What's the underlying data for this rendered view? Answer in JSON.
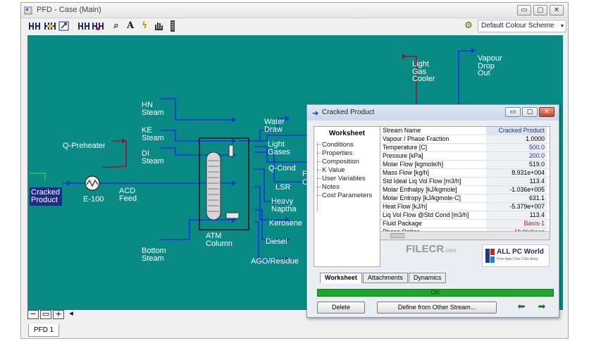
{
  "window": {
    "title": "PFD - Case (Main)",
    "min": "▭",
    "max": "▢",
    "close": "✕"
  },
  "toolbar": {
    "scheme_value": "Default Colour Scheme",
    "scheme_arrow": "▾",
    "icons": [
      "attach-icon",
      "detach-icon",
      "swap-icon",
      "break-icon",
      "merge-icon",
      "zoom-icon",
      "text-icon",
      "lightning-icon",
      "hand-icon",
      "column-icon",
      "palette-icon"
    ],
    "glyphs": {
      "text": "A",
      "zoom": "⌕",
      "lightning": "ϟ",
      "palette": "⚙"
    }
  },
  "pfd": {
    "feed_label": "Cracked\nProduct",
    "labels": {
      "q_preheater": "Q-Preheater",
      "e100": "E-100",
      "acd_feed": "ACD\nFeed",
      "hn_steam": "HN\nSteam",
      "ke_steam": "KE\nSteam",
      "di_steam": "DI\nSteam",
      "bottom_steam": "Bottom\nSteam",
      "atm_column": "ATM\nColumn",
      "water_draw": "Water\nDraw",
      "light_gases": "Light\nGases",
      "q_cond": "Q-Cond",
      "lsr": "LSR",
      "heavy_naptha": "Heavy\nNaptha",
      "kerosene": "Kerosene",
      "diesel": "Diesel",
      "ago_residue": "AGO/Residue",
      "light_gas_cooler": "Light\nGas\nCooler",
      "vapour_drop_out": "Vapour\nDrop\nOut",
      "partial_f": "F",
      "partial_c": "C"
    },
    "zoom_minus": "−",
    "zoom_fit": "▭",
    "zoom_plus": "+",
    "scroll_left": "◂",
    "tab": "PFD 1"
  },
  "dialog": {
    "title": "Cracked Product",
    "title_icon": "➜",
    "min": "▭",
    "max": "▢",
    "close": "✕",
    "nav_header": "Worksheet",
    "nav_items": [
      "Conditions",
      "Properties",
      "Composition",
      "K Value",
      "User Variables",
      "Notes",
      "Cost Parameters"
    ],
    "table": {
      "header": [
        "Stream Name",
        "Cracked Product"
      ],
      "rows": [
        {
          "k": "Vapour / Phase Fraction",
          "v": "1.0000",
          "c": ""
        },
        {
          "k": "Temperature [C]",
          "v": "500.0",
          "c": "blue"
        },
        {
          "k": "Pressure [kPa]",
          "v": "200.0",
          "c": "blue"
        },
        {
          "k": "Molar Flow [kgmole/h]",
          "v": "519.0",
          "c": ""
        },
        {
          "k": "Mass Flow [kg/h]",
          "v": "8.931e+004",
          "c": ""
        },
        {
          "k": "Std Ideal Liq Vol Flow [m3/h]",
          "v": "113.4",
          "c": ""
        },
        {
          "k": "Molar Enthalpy [kJ/kgmole]",
          "v": "-1.036e+005",
          "c": ""
        },
        {
          "k": "Molar Entropy [kJ/kgmole-C]",
          "v": "631.1",
          "c": ""
        },
        {
          "k": "Heat Flow [kJ/h]",
          "v": "-5.379e+007",
          "c": ""
        },
        {
          "k": "Liq Vol Flow @Std Cond [m3/h]",
          "v": "113.4",
          "c": ""
        },
        {
          "k": "Fluid Package",
          "v": "Basis-1",
          "c": "red"
        },
        {
          "k": "Phase Option",
          "v": "Multiphase",
          "c": "red"
        }
      ]
    },
    "watermark_left": "FILECR",
    "watermark_left_sub": ".com",
    "watermark_right": "ALL PC World",
    "watermark_right_sub": "Free Apps One Click Away",
    "tabs": [
      "Worksheet",
      "Attachments",
      "Dynamics"
    ],
    "status": "OK",
    "delete_label": "Delete",
    "define_label": "Define from Other Stream...",
    "prev_arrow": "⬅",
    "next_arrow": "➡"
  },
  "colors": {
    "canvas": "#0a8a84",
    "stream_blue": "#1433e0",
    "energy_red": "#8b1a32",
    "feed_box": "#1f2b8a"
  }
}
